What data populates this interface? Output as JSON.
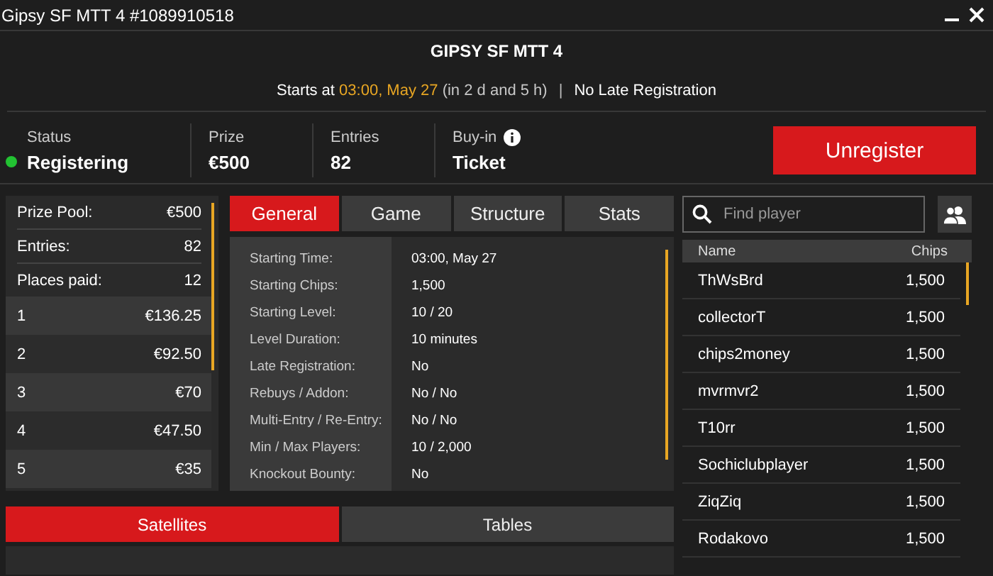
{
  "window": {
    "title": "Gipsy SF MTT 4 #1089910518"
  },
  "header": {
    "name": "GIPSY SF MTT 4",
    "starts_prefix": "Starts at",
    "start_time": "03:00, May 27",
    "countdown": "(in 2 d and 5 h)",
    "separator": "|",
    "late_registration": "No Late Registration"
  },
  "stats": [
    {
      "label": "Status",
      "value": "Registering",
      "color": "#22c232"
    },
    {
      "label": "Prize",
      "value": "€500"
    },
    {
      "label": "Entries",
      "value": "82"
    },
    {
      "label": "Buy-in",
      "value": "Ticket",
      "info": true
    }
  ],
  "action_button": "Unregister",
  "prize_summary": [
    {
      "label": "Prize Pool:",
      "value": "€500"
    },
    {
      "label": "Entries:",
      "value": "82"
    },
    {
      "label": "Places paid:",
      "value": "12"
    }
  ],
  "payouts": [
    {
      "place": "1",
      "amount": "€136.25"
    },
    {
      "place": "2",
      "amount": "€92.50"
    },
    {
      "place": "3",
      "amount": "€70"
    },
    {
      "place": "4",
      "amount": "€47.50"
    },
    {
      "place": "5",
      "amount": "€35"
    }
  ],
  "tabs": [
    {
      "label": "General",
      "selected": true
    },
    {
      "label": "Game",
      "selected": false
    },
    {
      "label": "Structure",
      "selected": false
    },
    {
      "label": "Stats",
      "selected": false
    }
  ],
  "details": [
    {
      "label": "Starting Time:",
      "value": "03:00, May 27"
    },
    {
      "label": "Starting Chips:",
      "value": "1,500"
    },
    {
      "label": "Starting Level:",
      "value": "10 / 20"
    },
    {
      "label": "Level Duration:",
      "value": "10 minutes"
    },
    {
      "label": "Late Registration:",
      "value": "No"
    },
    {
      "label": "Rebuys / Addon:",
      "value": "No / No"
    },
    {
      "label": "Multi-Entry / Re-Entry:",
      "value": "No / No"
    },
    {
      "label": "Min / Max Players:",
      "value": "10 / 2,000"
    },
    {
      "label": "Knockout Bounty:",
      "value": "No"
    }
  ],
  "bottom_tabs": [
    {
      "label": "Satellites",
      "selected": true
    },
    {
      "label": "Tables",
      "selected": false
    }
  ],
  "players": {
    "search": {
      "placeholder": "Find player"
    },
    "columns": [
      "Name",
      "Chips"
    ],
    "rows": [
      {
        "name": "ThWsBrd",
        "chips": "1,500"
      },
      {
        "name": "collectorT",
        "chips": "1,500"
      },
      {
        "name": "chips2money",
        "chips": "1,500"
      },
      {
        "name": "mvrmvr2",
        "chips": "1,500"
      },
      {
        "name": "T10rr",
        "chips": "1,500"
      },
      {
        "name": "Sochiclubplayer",
        "chips": "1,500"
      },
      {
        "name": "ZiqZiq",
        "chips": "1,500"
      },
      {
        "name": "Rodakovo",
        "chips": "1,500"
      }
    ]
  }
}
